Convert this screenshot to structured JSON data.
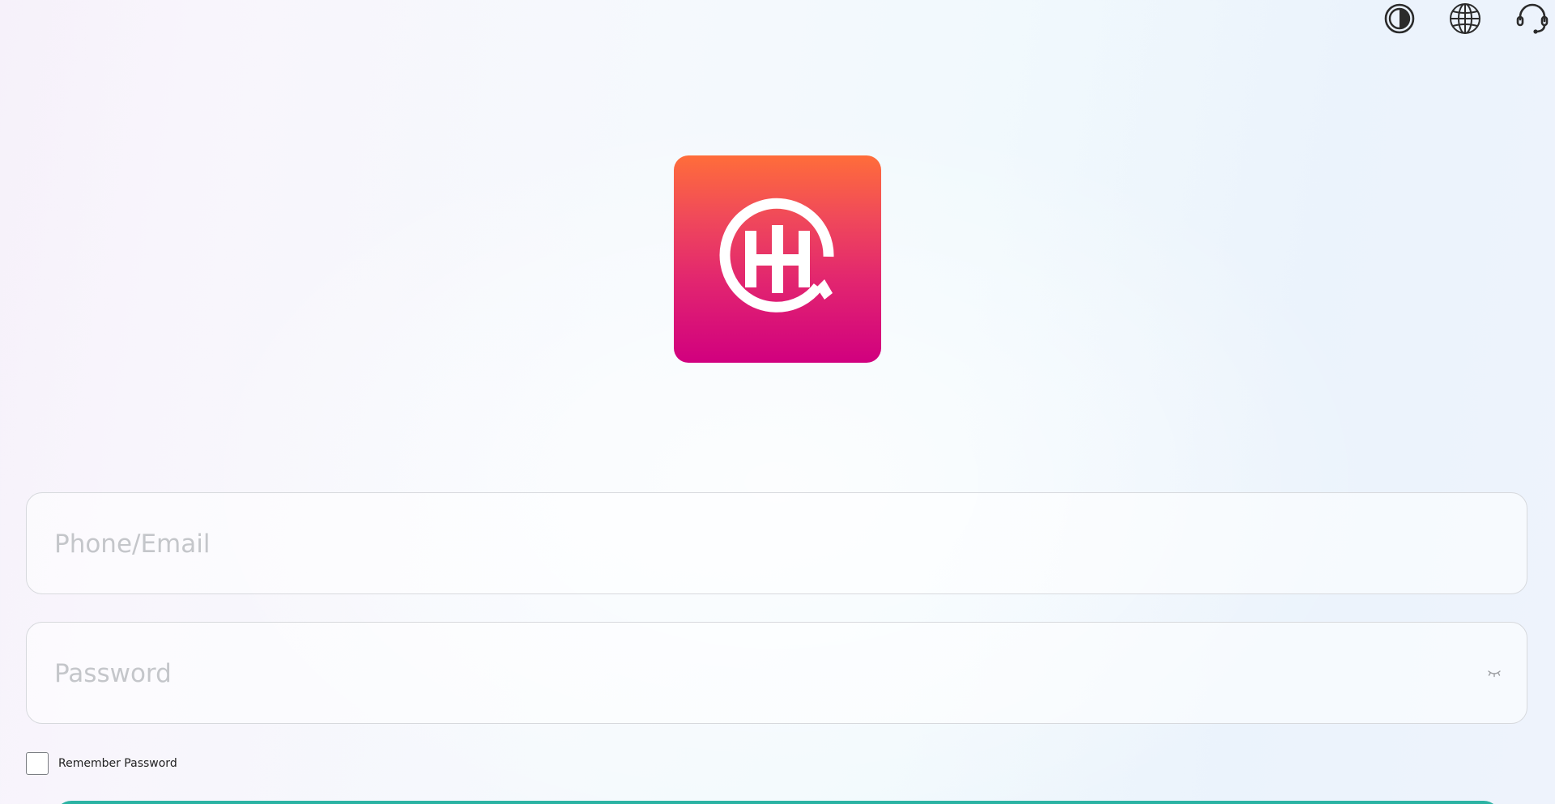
{
  "header": {
    "icons": [
      {
        "name": "contrast-icon"
      },
      {
        "name": "globe-icon"
      },
      {
        "name": "headset-icon"
      }
    ]
  },
  "logo": {
    "colors": {
      "top": "#ff6d3a",
      "bottom": "#d1007f"
    }
  },
  "form": {
    "phone_email": {
      "placeholder": "Phone/Email",
      "value": ""
    },
    "password": {
      "placeholder": "Password",
      "value": ""
    },
    "remember_label": "Remember Password",
    "remember_checked": false
  },
  "colors": {
    "accent": "#2bb3a3",
    "border": "#d7d9dd",
    "placeholder": "#c4c6ca"
  }
}
